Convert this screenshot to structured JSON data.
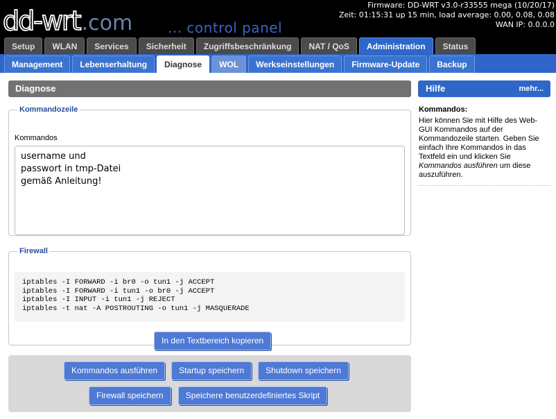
{
  "header": {
    "logo_main": "dd-wrt",
    "logo_tld": ".com",
    "tagline": "... control panel",
    "firmware": "Firmware: DD-WRT v3.0-r33555 mega (10/20/17)",
    "uptime": "Zeit: 01:15:31 up 15 min, load average: 0.00, 0.08, 0.08",
    "wan_ip": "WAN IP: 0.0.0.0"
  },
  "main_tabs": [
    "Setup",
    "WLAN",
    "Services",
    "Sicherheit",
    "Zugriffsbeschränkung",
    "NAT / QoS",
    "Administration",
    "Status"
  ],
  "sub_tabs": [
    "Management",
    "Lebenserhaltung",
    "Diagnose",
    "WOL",
    "Werkseinstellungen",
    "Firmware-Update",
    "Backup"
  ],
  "section": {
    "title": "Diagnose"
  },
  "command": {
    "legend": "Kommandozeile",
    "label": "Kommandos",
    "value": "username und\npasswort in tmp-Datei\ngemäß Anleitung!"
  },
  "firewall": {
    "legend": "Firewall",
    "rules": "iptables -I FORWARD -i br0 -o tun1 -j ACCEPT\niptables -I FORWARD -i tun1 -o br0 -j ACCEPT\niptables -I INPUT -i tun1 -j REJECT\niptables -t nat -A POSTROUTING -o tun1 -j MASQUERADE",
    "copy_label": "In den Textbereich kopieren"
  },
  "actions": {
    "run": "Kommandos ausführen",
    "startup": "Startup speichern",
    "shutdown": "Shutdown speichern",
    "firewall": "Firewall speichern",
    "custom": "Speichere benutzerdefiniertes Skript"
  },
  "help": {
    "title": "Hilfe",
    "more": "mehr...",
    "subtitle": "Kommandos:",
    "text_before": "Hier können Sie mit Hilfe des Web-GUI Kommandos auf der Kommandozeile starten. Geben Sie einfach Ihre Kommandos in das Textfeld ein und klicken Sie ",
    "text_em": "Kommandos ausführen",
    "text_after": " um diese auszuführen."
  }
}
